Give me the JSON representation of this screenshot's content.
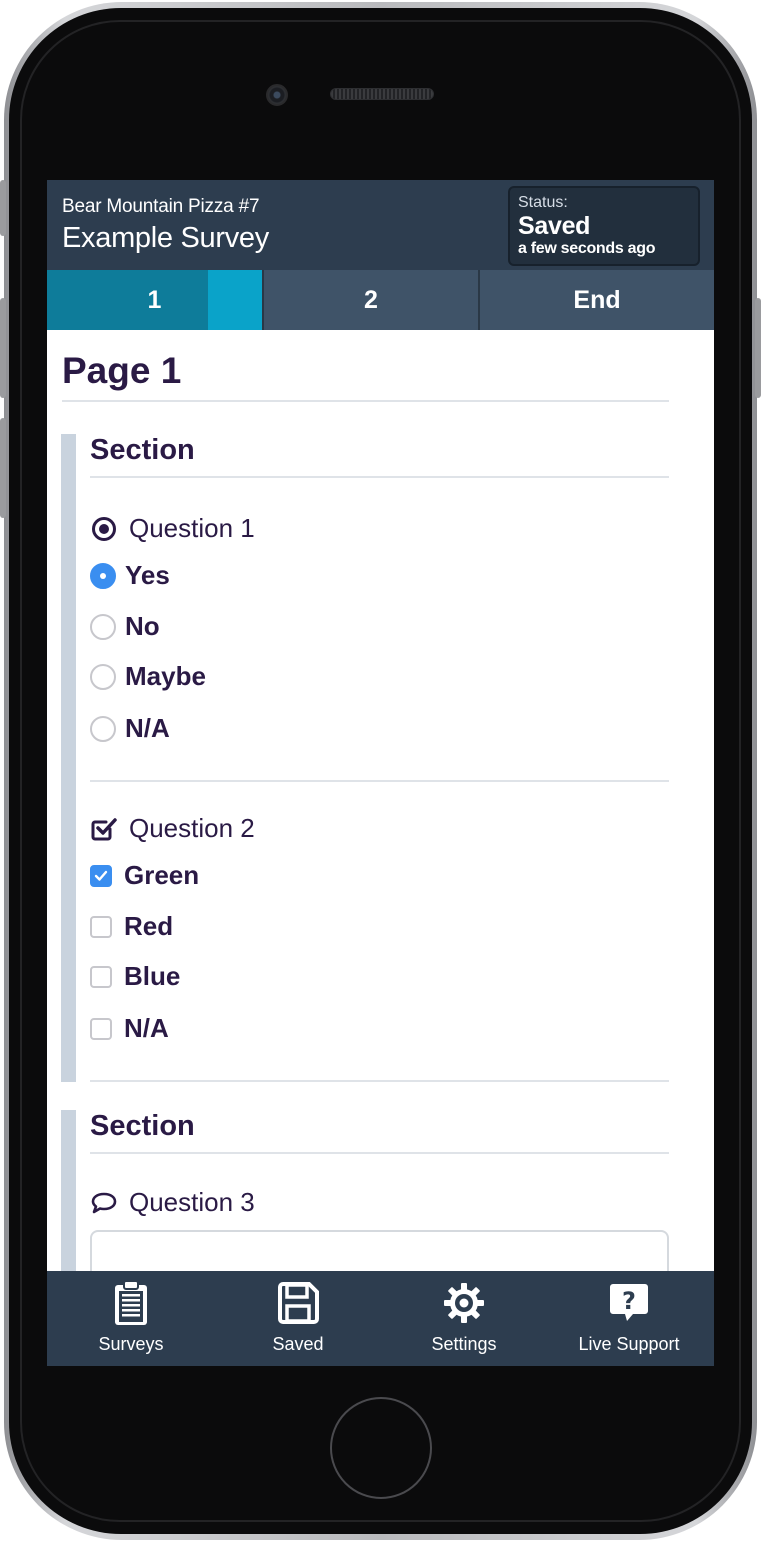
{
  "header": {
    "store_name": "Bear Mountain Pizza #7",
    "survey_title": "Example Survey",
    "status": {
      "label": "Status:",
      "value": "Saved",
      "time": "a few seconds ago"
    }
  },
  "tabs": [
    {
      "label": "1",
      "active": true,
      "progress": 0.25
    },
    {
      "label": "2",
      "active": false
    },
    {
      "label": "End",
      "active": false
    }
  ],
  "page": {
    "title": "Page 1"
  },
  "sections": [
    {
      "title": "Section",
      "questions": [
        {
          "title": "Question 1",
          "type": "radio",
          "icon": "radio-question-icon",
          "options": [
            {
              "label": "Yes",
              "selected": true
            },
            {
              "label": "No",
              "selected": false
            },
            {
              "label": "Maybe",
              "selected": false
            },
            {
              "label": "N/A",
              "selected": false
            }
          ]
        },
        {
          "title": "Question 2",
          "type": "checkbox",
          "icon": "checkbox-question-icon",
          "options": [
            {
              "label": "Green",
              "selected": true
            },
            {
              "label": "Red",
              "selected": false
            },
            {
              "label": "Blue",
              "selected": false
            },
            {
              "label": "N/A",
              "selected": false
            }
          ]
        }
      ]
    },
    {
      "title": "Section",
      "questions": [
        {
          "title": "Question 3",
          "type": "text",
          "icon": "comment-icon",
          "value": ""
        }
      ]
    }
  ],
  "bottom_nav": [
    {
      "label": "Surveys",
      "icon": "clipboard-icon"
    },
    {
      "label": "Saved",
      "icon": "floppy-disk-icon"
    },
    {
      "label": "Settings",
      "icon": "gear-icon"
    },
    {
      "label": "Live Support",
      "icon": "help-bubble-icon"
    }
  ],
  "colors": {
    "header_bg": "#2d3d4f",
    "tab_bg": "#3f5368",
    "tab_active": "#0e7c9a",
    "tab_progress": "#0aa3c9",
    "accent": "#3a8ef0",
    "text_dark": "#2a1a45",
    "section_bar": "#c9d3de"
  }
}
